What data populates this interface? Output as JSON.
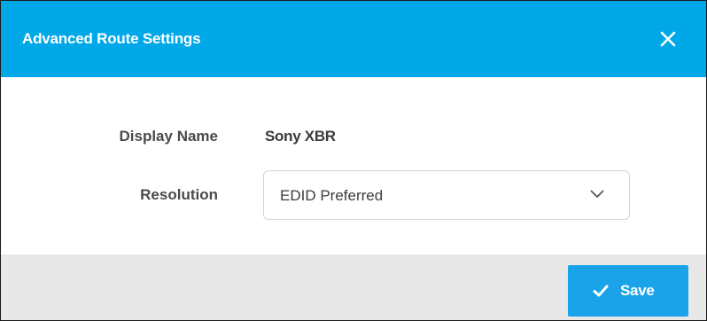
{
  "dialog": {
    "title": "Advanced Route Settings",
    "close_icon": "close-icon"
  },
  "form": {
    "display_name_label": "Display Name",
    "display_name_value": "Sony XBR",
    "resolution_label": "Resolution",
    "resolution_value": "EDID Preferred",
    "resolution_icon": "chevron-down-icon"
  },
  "footer": {
    "save_label": "Save",
    "save_icon": "check-icon"
  },
  "colors": {
    "header_bg": "#00a8e8",
    "footer_bg": "#e8e8e8",
    "save_bg": "#1aa3e8"
  }
}
